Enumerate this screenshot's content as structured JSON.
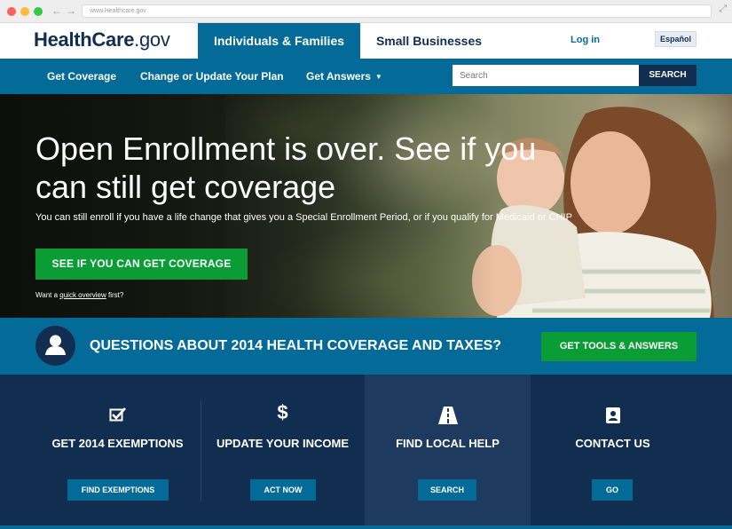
{
  "browser": {
    "url": "www.Healthcare.gov"
  },
  "header": {
    "logo_main": "HealthCare",
    "logo_suffix": ".gov",
    "tab_individuals": "Individuals & Families",
    "tab_small_business": "Small Businesses",
    "login": "Log in",
    "language": "Español"
  },
  "subnav": {
    "items": [
      "Get Coverage",
      "Change or Update Your Plan",
      "Get Answers"
    ],
    "search_placeholder": "Search",
    "search_button": "SEARCH"
  },
  "hero": {
    "title": "Open Enrollment is over. See if you can still get coverage",
    "subtitle": "You can still enroll if you have a life change that gives you a Special Enrollment Period, or if you qualify for Medicaid or CHIP",
    "cta": "SEE IF YOU CAN GET COVERAGE",
    "small_prefix": "Want a ",
    "small_link": "quick overview",
    "small_suffix": " first?"
  },
  "banner": {
    "text": "QUESTIONS ABOUT 2014 HEALTH COVERAGE AND TAXES?",
    "button": "GET TOOLS & ANSWERS"
  },
  "cards": [
    {
      "icon": "checkbox-icon",
      "title": "GET 2014 EXEMPTIONS",
      "button": "FIND EXEMPTIONS"
    },
    {
      "icon": "dollar-icon",
      "title": "UPDATE YOUR INCOME",
      "button": "ACT NOW"
    },
    {
      "icon": "road-icon",
      "title": "FIND LOCAL HELP",
      "button": "SEARCH"
    },
    {
      "icon": "contact-card-icon",
      "title": "CONTACT US",
      "button": "GO"
    }
  ],
  "colors": {
    "primary_blue": "#046b99",
    "navy": "#112e51",
    "green": "#0a9d35"
  }
}
